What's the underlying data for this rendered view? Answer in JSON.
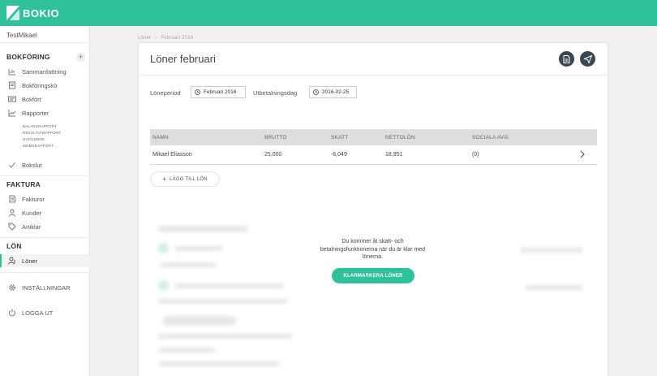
{
  "brand": {
    "name": "BOKIO",
    "color": "#2fc199"
  },
  "user": {
    "name": "TestMikael"
  },
  "sidebar": {
    "bokforing_title": "BOKFÖRING",
    "add_label": "+",
    "bokforing_items": [
      {
        "label": "Sammanfattning",
        "icon": "dashboard-icon"
      },
      {
        "label": "Bokföringskö",
        "icon": "queue-icon"
      },
      {
        "label": "Bokfört",
        "icon": "ledger-icon"
      },
      {
        "label": "Rapporter",
        "icon": "chart-icon"
      }
    ],
    "reports": [
      "BALANSRAPPORT",
      "RESULTATRAPPORT",
      "HUVUDBOK",
      "MOMSRAPPORT"
    ],
    "bokslut": {
      "label": "Bokslut",
      "icon": "check-icon"
    },
    "faktura_title": "FAKTURA",
    "faktura_items": [
      {
        "label": "Fakturor",
        "icon": "invoice-icon"
      },
      {
        "label": "Kunder",
        "icon": "person-icon"
      },
      {
        "label": "Artiklar",
        "icon": "tag-icon"
      }
    ],
    "lon_title": "LÖN",
    "lon_items": [
      {
        "label": "Löner",
        "icon": "payroll-icon",
        "active": true
      }
    ],
    "settings": {
      "label": "INSTÄLLNINGAR",
      "icon": "gear-icon"
    },
    "logout": {
      "label": "LOGGA UT",
      "icon": "power-icon"
    }
  },
  "breadcrumb": {
    "parent": "Löner",
    "separator": "›",
    "current": "Februari 2016"
  },
  "page": {
    "title": "Löner februari",
    "actions": [
      "document-icon",
      "send-icon"
    ]
  },
  "fields": {
    "period_label": "Löneperiod",
    "period_value": "Februari 2016",
    "payday_label": "Utbetalningsdag",
    "payday_value": "2016-02-25"
  },
  "table": {
    "headers": [
      "NAMN",
      "BRUTTO",
      "SKATT",
      "NETTOLÖN",
      "SOCIALA AVG."
    ],
    "rows": [
      {
        "name": "Mikael Eliasson",
        "brutto": "25,000",
        "skatt": "-6,049",
        "netto": "18,951",
        "sociala": "(0)"
      }
    ]
  },
  "add_button": {
    "icon": "+",
    "label": "LÄGG TILL LÖN"
  },
  "overlay": {
    "message": "Du kommer åt skatt- och betalningsfunktionerna när du är klar med lönerna.",
    "cta": "KLARMARKERA LÖNER"
  },
  "colors": {
    "accent": "#2fc199",
    "dark_button": "#3a4750",
    "table_header": "#dedede"
  }
}
